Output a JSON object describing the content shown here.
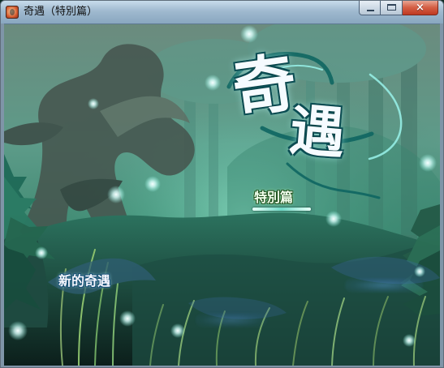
{
  "window": {
    "title": "奇遇（特別篇）",
    "minimize_icon": "minimize-icon",
    "maximize_icon": "maximize-icon",
    "close_icon": "close-icon",
    "close_glyph": "×"
  },
  "game": {
    "logo_char_1": "奇",
    "logo_char_2": "遇",
    "subtitle": "特別篇",
    "menu": {
      "new_game": "新的奇遇"
    }
  },
  "colors": {
    "logo_fill": "#f5fbff",
    "logo_outline": "#0c5158",
    "subtitle_fill": "#f2ffed",
    "menu_text": "#f7f8ff",
    "forest_green": "#1f6a58"
  }
}
